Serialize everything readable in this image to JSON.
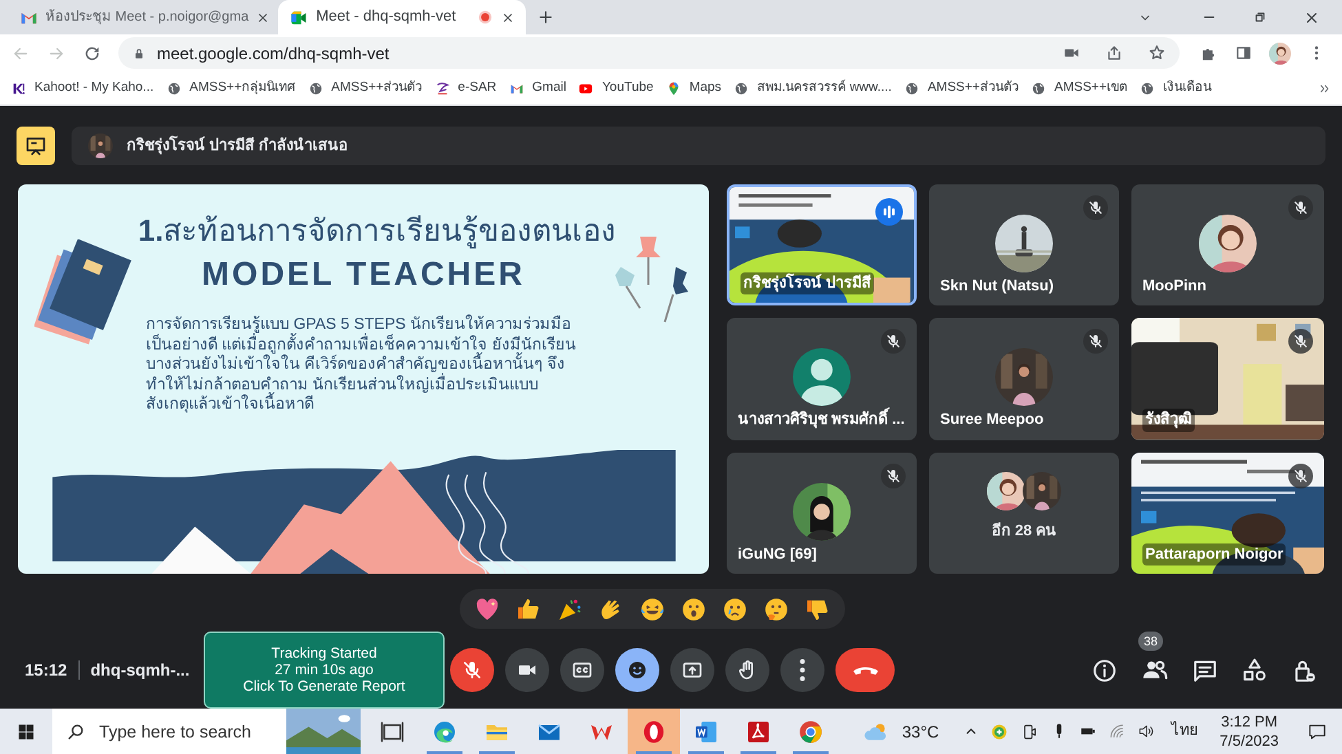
{
  "browser": {
    "tabs": [
      {
        "title": "ห้องประชุม Meet - p.noigor@gma",
        "kind": "gmail",
        "selected": false,
        "recording": false
      },
      {
        "title": "Meet - dhq-sqmh-vet",
        "kind": "meet",
        "selected": true,
        "recording": true
      }
    ],
    "address": "meet.google.com/dhq-sqmh-vet",
    "bookmarks": [
      {
        "label": "Kahoot! - My Kaho...",
        "kind": "kahoot"
      },
      {
        "label": "AMSS++กลุ่มนิเทศ",
        "kind": "globe"
      },
      {
        "label": "AMSS++ส่วนตัว",
        "kind": "globe"
      },
      {
        "label": "e-SAR",
        "kind": "esar"
      },
      {
        "label": "Gmail",
        "kind": "gmail"
      },
      {
        "label": "YouTube",
        "kind": "youtube"
      },
      {
        "label": "Maps",
        "kind": "maps"
      },
      {
        "label": "สพม.นครสวรรค์ www....",
        "kind": "globe"
      },
      {
        "label": "AMSS++ส่วนตัว",
        "kind": "globe"
      },
      {
        "label": "AMSS++เขต",
        "kind": "globe"
      },
      {
        "label": "เงินเดือน",
        "kind": "globe"
      }
    ]
  },
  "meet": {
    "presenter_banner": "กริชรุ่งโรจน์ ปารมีสี กำลังนำเสนอ",
    "slide": {
      "title": "**1.**สะท้อนการจัดการเรียนรู้ของตนเอง",
      "subtitle": "MODEL TEACHER",
      "body": "การจัดการเรียนรู้แบบ GPAS 5 STEPS นักเรียนให้ความร่วมมือ\nเป็นอย่างดี แต่เมื่อถูกตั้งคำถามเพื่อเช็คความเข้าใจ ยังมีนักเรียน\nบางส่วนยังไม่เข้าใจใน คีเวิร์ดของคำสำคัญของเนื้อหานั้นๆ จึง\nทำให้ไม่กล้าตอบคำถาม นักเรียนส่วนใหญ่เมื่อประเมินแบบ\nสังเกตุแล้วเข้าใจเนื้อหาดี"
    },
    "tiles": [
      {
        "name": "กริชรุ่งโรจน์ ปารมีสี",
        "kind": "video",
        "muted": false,
        "speaking": true
      },
      {
        "name": "Skn Nut (Natsu)",
        "kind": "avatar",
        "muted": true,
        "speaking": false
      },
      {
        "name": "MooPinn",
        "kind": "avatar",
        "muted": true,
        "speaking": false
      },
      {
        "name": "นางสาวศิริบุช พรมศักดิ์ ...",
        "kind": "default",
        "muted": true,
        "speaking": false
      },
      {
        "name": "Suree Meepoo",
        "kind": "avatar",
        "muted": true,
        "speaking": false
      },
      {
        "name": "รังสิวุฒิ",
        "kind": "camera",
        "muted": true,
        "speaking": false
      },
      {
        "name": "iGuNG [69]",
        "kind": "avatar",
        "muted": true,
        "speaking": false
      },
      {
        "name": "อีก 28 คน",
        "kind": "others",
        "muted": false,
        "speaking": false
      },
      {
        "name": "Pattaraporn Noigor",
        "kind": "video",
        "muted": true,
        "speaking": false
      }
    ],
    "time": "15:12",
    "meeting_code": "dhq-sqmh-...",
    "tracking": "Tracking Started\n27 min 10s ago\nClick To Generate Report",
    "controls": [
      {
        "kind": "mic",
        "muted": true,
        "selected": false
      },
      {
        "kind": "camera",
        "muted": false,
        "selected": false
      },
      {
        "kind": "captions",
        "muted": false,
        "selected": false
      },
      {
        "kind": "reactions",
        "muted": false,
        "selected": true
      },
      {
        "kind": "present",
        "muted": false,
        "selected": false
      },
      {
        "kind": "hand",
        "muted": false,
        "selected": false
      },
      {
        "kind": "more",
        "muted": false,
        "selected": false
      },
      {
        "kind": "leave",
        "muted": false,
        "selected": false
      }
    ],
    "participant_count": "38"
  },
  "taskbar": {
    "search_placeholder": "Type here to search",
    "apps": [
      {
        "kind": "taskview",
        "running": false,
        "selected": false
      },
      {
        "kind": "edge",
        "running": true,
        "selected": false
      },
      {
        "kind": "explorer",
        "running": true,
        "selected": false
      },
      {
        "kind": "mail",
        "running": false,
        "selected": false
      },
      {
        "kind": "wps",
        "running": false,
        "selected": false
      },
      {
        "kind": "opera",
        "running": true,
        "selected": true
      },
      {
        "kind": "word",
        "running": true,
        "selected": false
      },
      {
        "kind": "acrobat",
        "running": true,
        "selected": false
      },
      {
        "kind": "chrome",
        "running": true,
        "selected": false
      }
    ],
    "temperature": "33°C",
    "language": "ไทย",
    "time": "3:12 PM",
    "date": "7/5/2023"
  }
}
